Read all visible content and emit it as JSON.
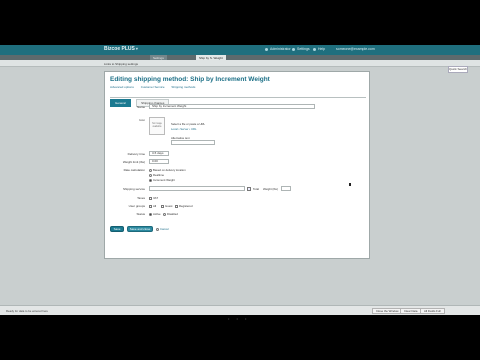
{
  "app": {
    "brand": "Bizcoe PLUS",
    "top_links": [
      "Administrator",
      "Settings",
      "Help",
      "someone@example.com"
    ]
  },
  "tabs": [
    "Settings",
    "Ship by S. Weight"
  ],
  "breadcrumb": "Links to Shipping settings",
  "quick_button": "Quick Search",
  "page": {
    "title": "Editing shipping method: Ship by Increment Weight",
    "links": [
      "Advanced options",
      "Customer Service",
      "Shipping methods"
    ],
    "tabs": [
      "General",
      "Shipping charges"
    ],
    "fields": {
      "name_label": "Name",
      "name_value": "Ship by Increment Weight",
      "icon_label": "Icon",
      "icon_placeholder": "No image available",
      "icon_hint": "Select a file or paste a URL",
      "icon_links": "Local  •  Server  •  URL",
      "alt_label": "Alternative text",
      "delivery_label": "Delivery time",
      "delivery_value": "3-5 days",
      "weight_label": "Weight limit (lbs)",
      "weight_value": "0.00",
      "avail_label": "Rate calculation",
      "avail_options": [
        "Based on delivery location",
        "Realtime",
        "Increment Weight"
      ],
      "shipping_label": "Shipping service",
      "taxes_label": "Taxes",
      "taxes_value": "VAT",
      "user_groups_label": "User groups",
      "user_groups_options": [
        "All",
        "Guest",
        "Registered"
      ],
      "status_label": "Status",
      "status_options": [
        "Active",
        "Disabled"
      ],
      "total_label": "Total",
      "weight_rate_label": "Weight (lbs)"
    },
    "buttons": {
      "save": "Save",
      "save_close": "Save and close",
      "cancel": "Cancel"
    }
  },
  "statusbar": {
    "left_text": "Ready for data to be entered here",
    "buttons": [
      "Close the Window",
      "Clear Data",
      "All Fields Full"
    ]
  }
}
